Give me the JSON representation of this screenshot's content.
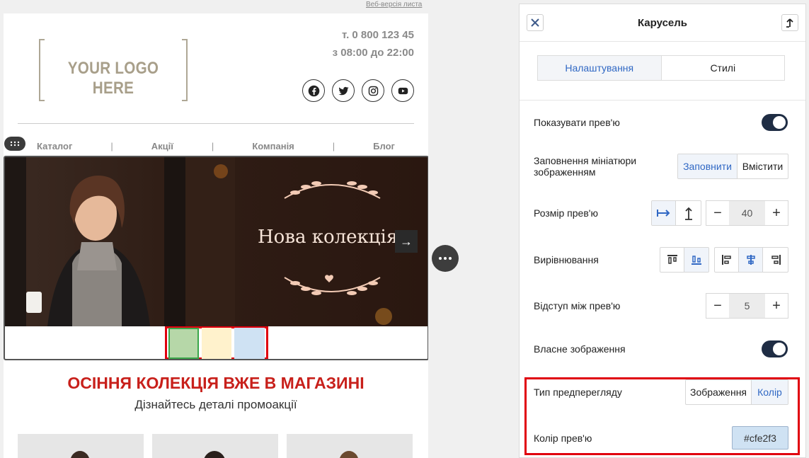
{
  "email": {
    "web_version_link": "Веб-версія листа",
    "logo_text": "YOUR LOGO HERE",
    "phone": "т. 0 800 123 45",
    "hours": "з 08:00 до 22:00",
    "social_icons": [
      "facebook-icon",
      "twitter-icon",
      "instagram-icon",
      "youtube-icon"
    ],
    "menu": [
      {
        "label": "Каталог"
      },
      {
        "label": "Акції"
      },
      {
        "label": "Компанія"
      },
      {
        "label": "Блог"
      }
    ],
    "menu_separator": "|",
    "carousel": {
      "slide_title": "Нова колекція",
      "next_arrow": "→",
      "thumbnail_colors": [
        "#b6d7a8",
        "#fff2cc",
        "#cfe2f3"
      ]
    },
    "promo_title": "ОСІННЯ КОЛЕКЦІЯ ВЖЕ В МАГАЗИНІ",
    "promo_subtitle": "Дізнайтесь деталі промоакції"
  },
  "panel": {
    "title": "Карусель",
    "tabs": [
      {
        "label": "Налаштування",
        "active": true
      },
      {
        "label": "Стилі",
        "active": false
      }
    ],
    "show_preview": {
      "label": "Показувати прев'ю",
      "on": true
    },
    "fill_thumbnail": {
      "label": "Заповнення мініатюри зображенням",
      "options": [
        "Заповнити",
        "Вмістити"
      ],
      "selected": "Заповнити"
    },
    "preview_size": {
      "label": "Розмір прев'ю",
      "value": "40",
      "selected_icon": "width-arrow-icon"
    },
    "alignment": {
      "label": "Вирівнювання"
    },
    "preview_gap": {
      "label": "Відступ між прев'ю",
      "value": "5"
    },
    "custom_image": {
      "label": "Власне зображення",
      "on": true
    },
    "preview_type": {
      "label": "Тип предперегляду",
      "options": [
        "Зображення",
        "Колір"
      ],
      "selected": "Колір"
    },
    "preview_color": {
      "label": "Колір прев'ю",
      "value": "#cfe2f3"
    }
  },
  "colors": {
    "accent": "#3068c4",
    "toggle": "#1f2d44",
    "highlight": "#e0000e",
    "promo_title": "#c8201b"
  }
}
